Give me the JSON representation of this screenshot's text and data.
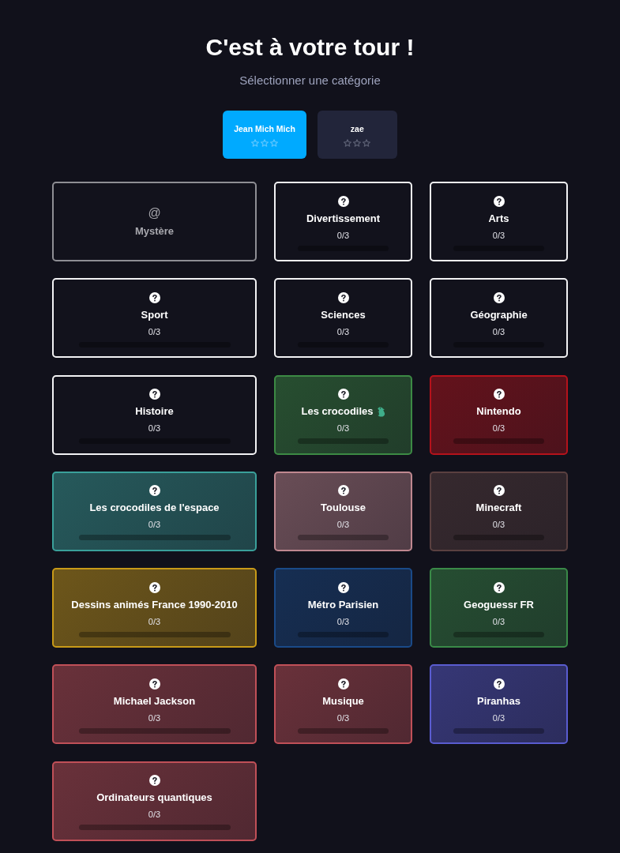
{
  "header": {
    "title": "C'est à votre tour !",
    "subtitle": "Sélectionner une catégorie"
  },
  "players": [
    {
      "name": "Jean Mich Mich",
      "selected": true,
      "stars": 0
    },
    {
      "name": "zae",
      "selected": false,
      "stars": 0
    }
  ],
  "categories": [
    {
      "kind": "mystery",
      "symbol": "@",
      "name": "Mystère"
    },
    {
      "kind": "category",
      "name": "Divertissement",
      "progress": "0/3",
      "level": 0
    },
    {
      "kind": "category",
      "name": "Arts",
      "progress": "0/3",
      "level": 0
    },
    {
      "kind": "category",
      "name": "Sport",
      "progress": "0/3",
      "level": 0
    },
    {
      "kind": "category",
      "name": "Sciences",
      "progress": "0/3",
      "level": 0
    },
    {
      "kind": "category",
      "name": "Géographie",
      "progress": "0/3",
      "level": 0
    },
    {
      "kind": "category",
      "name": "Histoire",
      "progress": "0/3",
      "level": 0
    },
    {
      "kind": "category",
      "name": "Les crocodiles",
      "emoji": true,
      "progress": "0/3",
      "level": 0,
      "color": "#3c8a44"
    },
    {
      "kind": "category",
      "name": "Nintendo",
      "progress": "0/3",
      "level": 0,
      "color": "#b5121b"
    },
    {
      "kind": "category",
      "name": "Les crocodiles de l'espace",
      "progress": "0/3",
      "level": 0,
      "color": "#3aa09a"
    },
    {
      "kind": "category",
      "name": "Toulouse",
      "progress": "0/3",
      "level": 0,
      "color": "#c08890"
    },
    {
      "kind": "category",
      "name": "Minecraft",
      "progress": "0/3",
      "level": 0,
      "color": "#5a4040"
    },
    {
      "kind": "category",
      "name": "Dessins animés France 1990-2010",
      "progress": "0/3",
      "level": 0,
      "color": "#c89a18"
    },
    {
      "kind": "category",
      "name": "Métro Parisien",
      "progress": "0/3",
      "level": 0,
      "color": "#1a4a88"
    },
    {
      "kind": "category",
      "name": "Geoguessr FR",
      "progress": "0/3",
      "level": 0,
      "color": "#3a8a48"
    },
    {
      "kind": "category",
      "name": "Michael Jackson",
      "progress": "0/3",
      "level": 0,
      "color": "#c05058"
    },
    {
      "kind": "category",
      "name": "Musique",
      "progress": "0/3",
      "level": 0,
      "color": "#c05058"
    },
    {
      "kind": "category",
      "name": "Piranhas",
      "progress": "0/3",
      "level": 0,
      "color": "#5a5cd0"
    },
    {
      "kind": "category",
      "name": "Ordinateurs quantiques",
      "progress": "0/3",
      "level": 0,
      "color": "#c05058"
    }
  ]
}
